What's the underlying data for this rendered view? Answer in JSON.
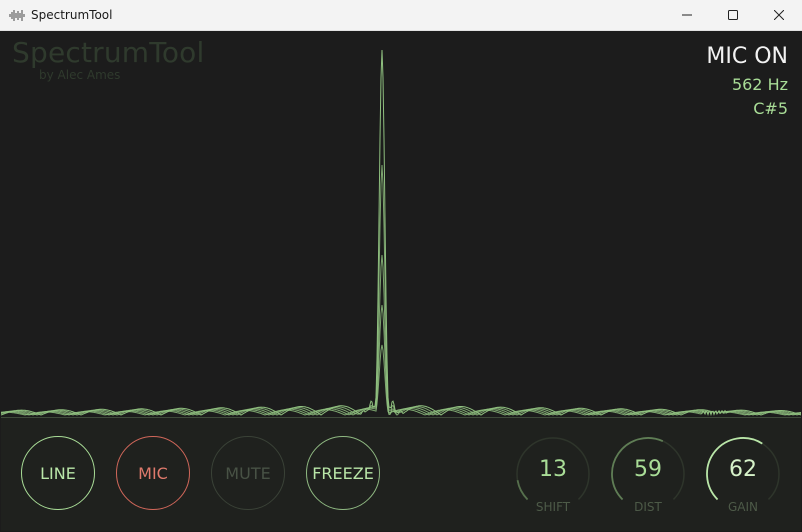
{
  "window": {
    "title": "SpectrumTool"
  },
  "branding": {
    "name": "SpectrumTool",
    "byline": "by Alec Ames"
  },
  "readout": {
    "status": "MIC ON",
    "frequency": "562 Hz",
    "note": "C#5"
  },
  "buttons": [
    {
      "label": "LINE",
      "state": "active"
    },
    {
      "label": "MIC",
      "state": "on"
    },
    {
      "label": "MUTE",
      "state": "disabled"
    },
    {
      "label": "FREEZE",
      "state": "idle"
    }
  ],
  "knobs": [
    {
      "label": "SHIFT",
      "value": "13",
      "level": 0.13
    },
    {
      "label": "DIST",
      "value": "59",
      "level": 0.59
    },
    {
      "label": "GAIN",
      "value": "62",
      "level": 0.62
    }
  ],
  "colors": {
    "accent": "#a9dd97",
    "mic_on": "#e07a6c",
    "disabled": "#485245",
    "status_text": "#f2f2f2",
    "background": "#1c1c1c"
  },
  "icons": {
    "app": "waveform-icon",
    "minimize": "minimize-icon",
    "maximize": "maximize-icon",
    "close": "close-icon"
  }
}
